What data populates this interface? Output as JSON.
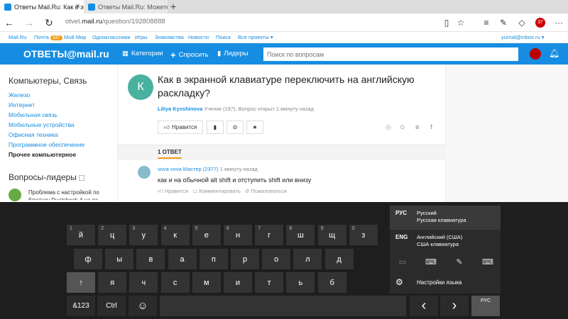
{
  "browser": {
    "tabs": [
      {
        "title": "Ответы Mail.Ru: Как в э"
      },
      {
        "title": "Ответы Mail.Ru: Можете пс"
      }
    ],
    "url_prefix": "otvet.",
    "url_domain": "mail.ru",
    "url_path": "/question/192808888",
    "icons": [
      "back-icon",
      "forward-icon",
      "refresh-icon",
      "reading-view-icon",
      "favorite-star-icon",
      "hub-icon",
      "notes-icon",
      "share-icon",
      "extension-icon",
      "more-icon"
    ],
    "ext_badge": "37"
  },
  "mailbar": {
    "items": [
      "Mail.Ru",
      "Почта",
      "Мой Мир",
      "Одноклассники",
      "Игры",
      "Знакомства",
      "Новости",
      "Поиск",
      "Все проекты ▾"
    ],
    "mail_count": "347",
    "user": "yurnal@inbox.ru ▾"
  },
  "header": {
    "logo": "ОТВЕТЫ@mail.ru",
    "categories": "Категории",
    "ask": "Спросить",
    "leaders": "Лидеры",
    "search_placeholder": "Поиск по вопросам"
  },
  "sidebar": {
    "title": "Компьютеры, Связь",
    "links": [
      "Железо",
      "Интернет",
      "Мобильная связь",
      "Мобильные устройства",
      "Офисная техника",
      "Программное обеспечение"
    ],
    "active": "Прочее компьютерное",
    "leaders_title": "Вопросы-лидеры",
    "leader_q": "Проблема с настройкой по блютузу Dualshock 4 на пс"
  },
  "question": {
    "avatar_letter": "К",
    "title": "Как в экранной клавиатуре переключить на английскую раскладку?",
    "author": "Liliya Kyvshinova",
    "meta": "Ученик (197), Вопрос открыт 1 минуту назад",
    "like_label": "Нравится"
  },
  "answers": {
    "count_label": "1 ОТВЕТ",
    "items": [
      {
        "author": "vova vova",
        "rank": "Мастер (2377)",
        "time": "1 минуту назад",
        "text": "как и на обычной alt shift и отступить shift или внизу",
        "like": "Нравится",
        "comment": "Комментировать",
        "report": "Пожаловаться"
      }
    ]
  },
  "keyboard": {
    "row1": [
      {
        "k": "й",
        "s": "1"
      },
      {
        "k": "ц",
        "s": "2"
      },
      {
        "k": "у",
        "s": "3"
      },
      {
        "k": "к",
        "s": "4"
      },
      {
        "k": "е",
        "s": "5"
      },
      {
        "k": "н",
        "s": "6"
      },
      {
        "k": "г",
        "s": "7"
      },
      {
        "k": "ш",
        "s": "8"
      },
      {
        "k": "щ",
        "s": "9"
      },
      {
        "k": "з",
        "s": "0"
      }
    ],
    "row2": [
      "ф",
      "ы",
      "в",
      "а",
      "п",
      "р",
      "о",
      "л",
      "д"
    ],
    "row3": [
      "↑",
      "я",
      "ч",
      "с",
      "м",
      "и",
      "т",
      "ь",
      "б"
    ],
    "sym": "&123",
    "ctrl": "Ctrl",
    "emoji": "☺",
    "prev": "‹",
    "next": "›",
    "lang_key": "РУС",
    "languages": [
      {
        "code": "РУС",
        "name": "Русский",
        "layout": "Русская клавиатура"
      },
      {
        "code": "ENG",
        "name": "Английский (США)",
        "layout": "США клавиатура"
      }
    ],
    "lang_settings": "Настройки языка"
  }
}
